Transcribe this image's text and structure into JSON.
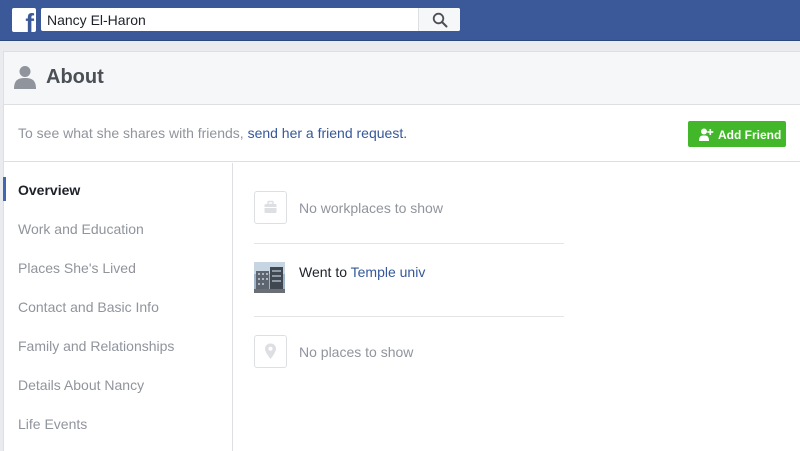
{
  "topbar": {
    "logo": "f",
    "search_value": "Nancy El-Haron"
  },
  "header": {
    "title": "About"
  },
  "notice": {
    "text": "To see what she shares with friends, ",
    "link": "send her a friend request."
  },
  "actions": {
    "add_friend_label": "Add Friend"
  },
  "sidebar": {
    "items": [
      {
        "label": "Overview",
        "active": true
      },
      {
        "label": "Work and Education"
      },
      {
        "label": "Places She's Lived"
      },
      {
        "label": "Contact and Basic Info"
      },
      {
        "label": "Family and Relationships"
      },
      {
        "label": "Details About Nancy"
      },
      {
        "label": "Life Events"
      }
    ]
  },
  "overview": {
    "work": {
      "text": "No workplaces to show",
      "icon": "briefcase-icon"
    },
    "education": {
      "prefix": "Went to ",
      "link": "Temple univ",
      "icon": "school-photo"
    },
    "places": {
      "text": "No places to show",
      "icon": "map-pin-icon"
    }
  },
  "colors": {
    "brand": "#3b5998",
    "link": "#365899",
    "add_friend": "#42b72a"
  }
}
